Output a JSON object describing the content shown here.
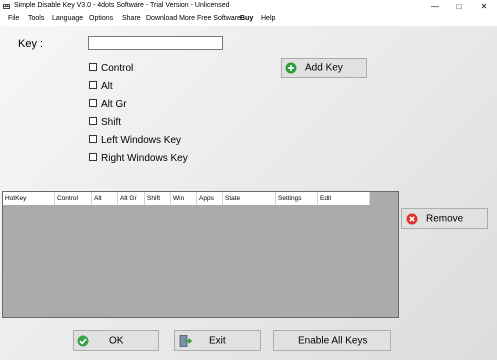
{
  "window": {
    "title": "Simple Disable Key V3.0 - 4dots Software - Trial Version - Unlicensed"
  },
  "menu": [
    "File",
    "Tools",
    "Language",
    "Options",
    "Share",
    "Download More Free Software",
    "Buy",
    "Help"
  ],
  "key_label": "Key :",
  "key_input_value": "",
  "checkboxes": [
    "Control",
    "Alt",
    "Alt Gr",
    "Shift",
    "Left Windows Key",
    "Right Windows Key"
  ],
  "buttons": {
    "add_key": "Add Key",
    "remove": "Remove",
    "ok": "OK",
    "exit": "Exit",
    "enable_all": "Enable All Keys"
  },
  "table": {
    "columns": [
      "HotKey",
      "Control",
      "Alt",
      "Alt Gr",
      "Shift",
      "Win",
      "Apps",
      "State",
      "Settings",
      "Edit"
    ]
  }
}
